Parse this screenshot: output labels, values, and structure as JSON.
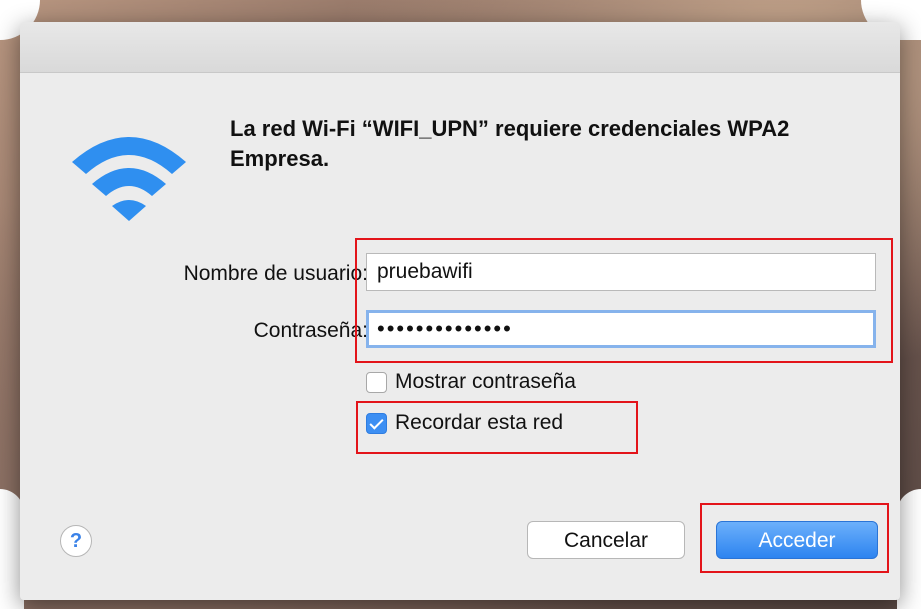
{
  "dialog": {
    "title": "La red Wi-Fi “WIFI_UPN” requiere credenciales WPA2 Empresa.",
    "username_label": "Nombre de usuario:",
    "username_value": "pruebawifi",
    "password_label": "Contraseña:",
    "password_value": "••••••••••••••",
    "show_password_label": "Mostrar contraseña",
    "show_password_checked": false,
    "remember_label": "Recordar esta red",
    "remember_checked": true,
    "help_label": "?",
    "cancel_label": "Cancelar",
    "ok_label": "Acceder"
  },
  "icons": {
    "wifi": "wifi-icon",
    "help": "help-icon",
    "check": "checkmark-icon"
  },
  "colors": {
    "accent": "#2d84f0",
    "highlight_box": "#e3141a",
    "focus_ring": "#86b3ec",
    "wifi_icon": "#2f8ff0"
  }
}
